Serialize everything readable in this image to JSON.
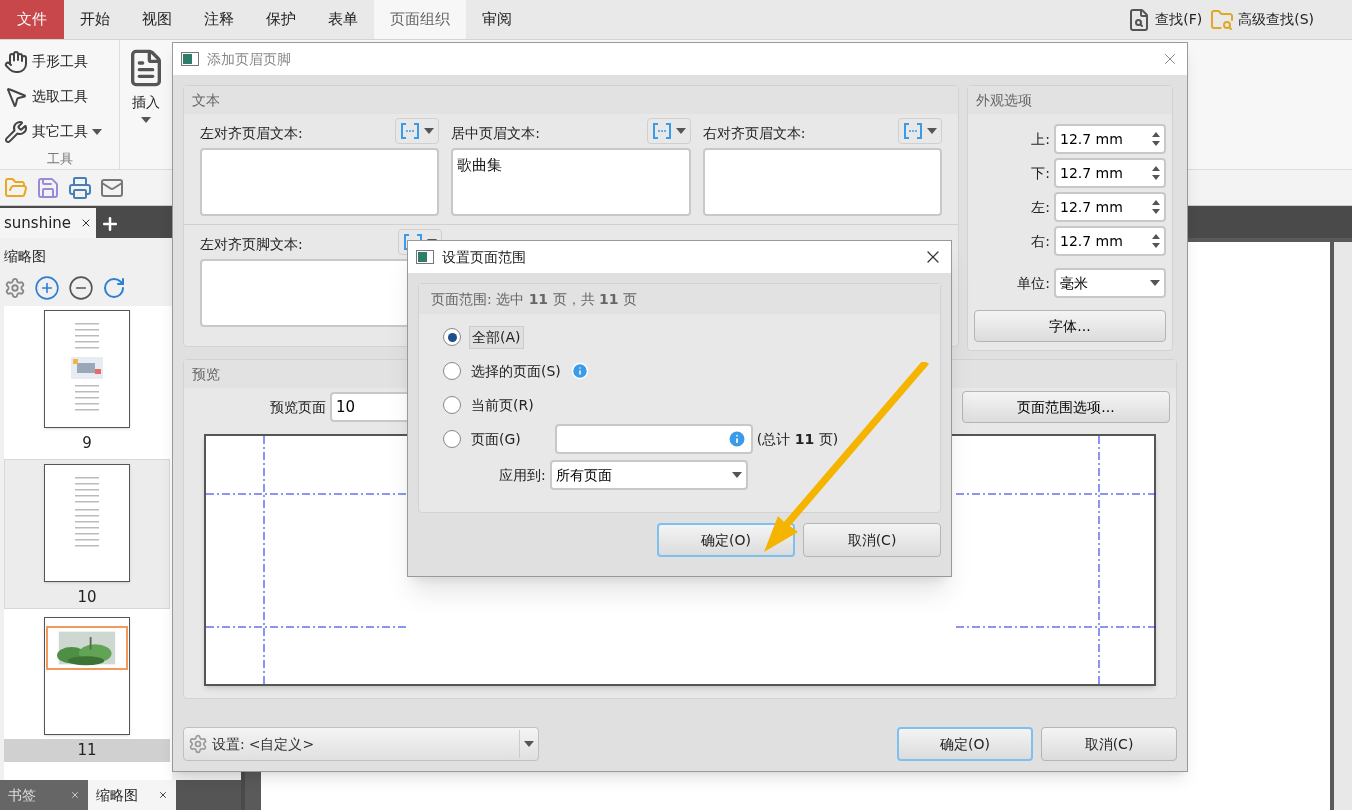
{
  "menu_tabs": [
    {
      "label": "文件",
      "kind": "file",
      "selected": false
    },
    {
      "label": "开始",
      "kind": "tab",
      "selected": false
    },
    {
      "label": "视图",
      "kind": "tab",
      "selected": false
    },
    {
      "label": "注释",
      "kind": "tab",
      "selected": false
    },
    {
      "label": "保护",
      "kind": "tab",
      "selected": false
    },
    {
      "label": "表单",
      "kind": "tab",
      "selected": false
    },
    {
      "label": "页面组织",
      "kind": "tab",
      "selected": true
    },
    {
      "label": "审阅",
      "kind": "tab",
      "selected": false
    }
  ],
  "search_buttons": [
    "查找(F)",
    "高级查找(S)"
  ],
  "tools": [
    {
      "label": "手形工具",
      "kind": "plain"
    },
    {
      "label": "选取工具",
      "kind": "plain"
    },
    {
      "label": "其它工具",
      "kind": "menu"
    }
  ],
  "tools_group_label": "工具",
  "insert_label": "插入",
  "doc_tab": {
    "title": "sunshine"
  },
  "thumbnail_panel": {
    "title": "缩略图",
    "pages": [
      {
        "label": "9",
        "kind": "illustration",
        "selected": false
      },
      {
        "label": "10",
        "kind": "text",
        "selected": false
      },
      {
        "label": "11",
        "selected": true
      }
    ]
  },
  "bottom_tabs": [
    {
      "label": "书签",
      "selected": false
    },
    {
      "label": "缩略图",
      "selected": true
    }
  ],
  "header_footer_dialog": {
    "title": "添加页眉页脚",
    "text_group": {
      "title": "文本",
      "header_fields": [
        {
          "label": "左对齐页眉文本:"
        },
        {
          "label": "居中页眉文本:",
          "value": "歌曲集"
        },
        {
          "label": "右对齐页眉文本:"
        }
      ],
      "footer_fields": [
        {
          "label": "左对齐页脚文本:"
        }
      ]
    },
    "appearance_group": {
      "title": "外观选项",
      "margins": [
        {
          "label": "上:",
          "value": "12.7 mm"
        },
        {
          "label": "下:",
          "value": "12.7 mm"
        },
        {
          "label": "左:",
          "value": "12.7 mm"
        },
        {
          "label": "右:",
          "value": "12.7 mm"
        }
      ],
      "unit": {
        "label": "单位:",
        "value": "毫米"
      },
      "font_button": "字体..."
    },
    "preview_group": {
      "title": "预览",
      "page_label": "预览页面",
      "page_value": "10",
      "range_button": "页面范围选项..."
    },
    "settings": {
      "label": "设置:",
      "value": "<自定义>"
    },
    "buttons": [
      {
        "label": "确定(O)",
        "default": true
      },
      {
        "label": "取消(C)",
        "default": false
      }
    ]
  },
  "page_range_dialog": {
    "title": "设置页面范围",
    "summary": "页面范围: 选中 **11** 页，共 **11** 页",
    "options": [
      {
        "label": "全部(A)",
        "kind": "plain",
        "info": false,
        "selected": true
      },
      {
        "label": "选择的页面(S)",
        "kind": "plain",
        "info": true,
        "selected": false
      },
      {
        "label": "当前页(R)",
        "kind": "plain",
        "info": false,
        "selected": false
      },
      {
        "label": "页面(G)",
        "kind": "input",
        "info": false,
        "selected": false
      }
    ],
    "total": "(总计 **11** 页)",
    "apply_label": "应用到:",
    "apply_value": "所有页面",
    "buttons": [
      {
        "label": "确定(O)",
        "default": true
      },
      {
        "label": "取消(C)",
        "default": false
      }
    ]
  }
}
